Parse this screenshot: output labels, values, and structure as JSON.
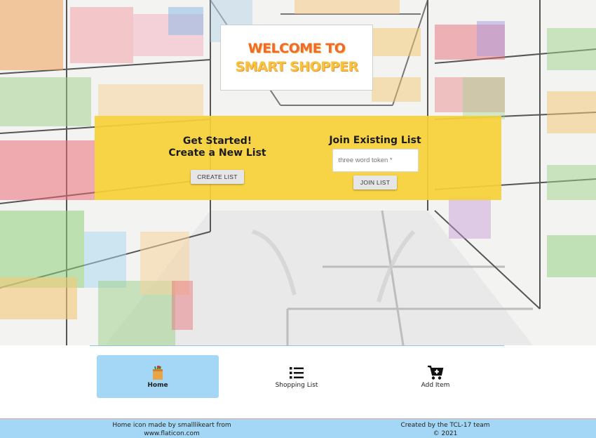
{
  "hero": {
    "welcome_line1": "WELCOME TO",
    "welcome_line2": "SMART SHOPPER"
  },
  "create_panel": {
    "heading_line1": "Get Started!",
    "heading_line2": "Create a New List",
    "button_label": "CREATE LIST"
  },
  "join_panel": {
    "heading": "Join Existing List",
    "token_placeholder": "three word token *",
    "token_value": "",
    "button_label": "JOIN LIST"
  },
  "nav": {
    "items": [
      {
        "label": "Home",
        "icon": "grocery-bag-icon",
        "active": true
      },
      {
        "label": "Shopping List",
        "icon": "list-icon",
        "active": false
      },
      {
        "label": "Add Item",
        "icon": "cart-plus-icon",
        "active": false
      }
    ]
  },
  "footer": {
    "credit_line1": "Home icon made by smalllikeart from",
    "credit_line2": "www.flaticon.com",
    "created_line1": "Created by the TCL-17 team",
    "created_line2": "© 2021"
  },
  "colors": {
    "panel_yellow": "#f6d039",
    "nav_active": "#a3d7f5",
    "footer_blue": "#a3d7f5",
    "welcome_orange": "#ef6a2c",
    "welcome_yellow": "#f6c53f"
  }
}
